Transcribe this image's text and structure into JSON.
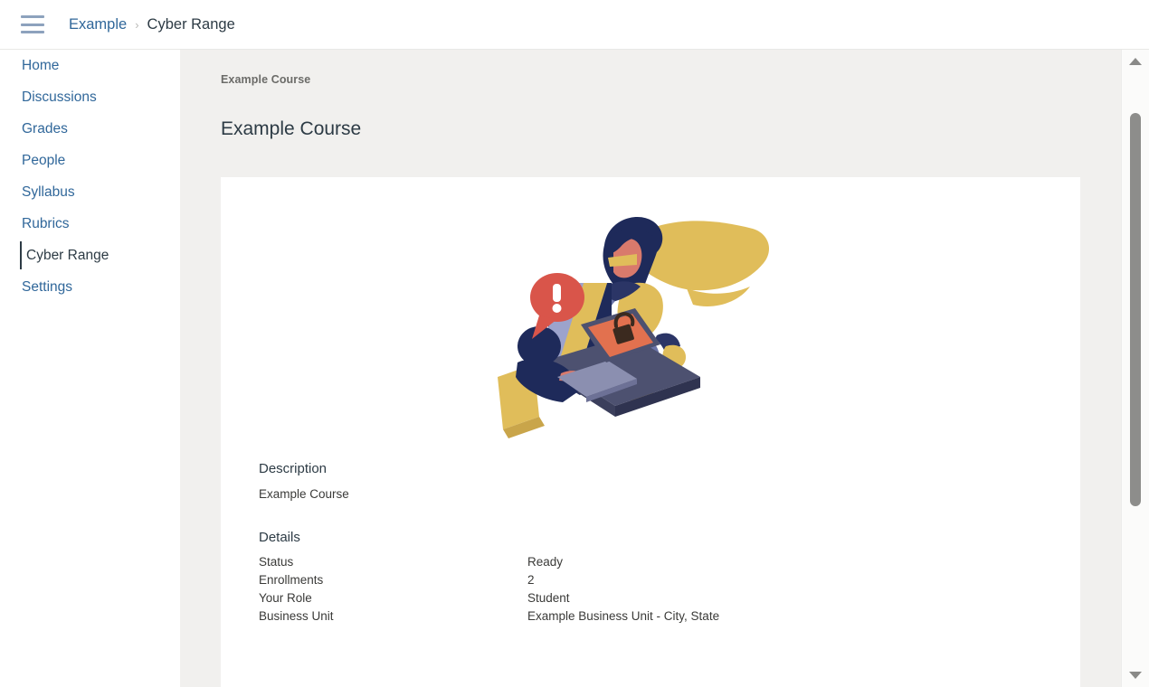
{
  "header": {
    "menu_icon": "hamburger-menu-icon",
    "breadcrumb": {
      "root_label": "Example",
      "separator": "›",
      "current_label": "Cyber Range"
    }
  },
  "sidebar": {
    "items": [
      {
        "label": "Home",
        "active": false
      },
      {
        "label": "Discussions",
        "active": false
      },
      {
        "label": "Grades",
        "active": false
      },
      {
        "label": "People",
        "active": false
      },
      {
        "label": "Syllabus",
        "active": false
      },
      {
        "label": "Rubrics",
        "active": false
      },
      {
        "label": "Cyber Range",
        "active": true
      },
      {
        "label": "Settings",
        "active": false
      }
    ]
  },
  "main": {
    "sub_breadcrumb": "Example Course",
    "page_title": "Example Course",
    "illustration": {
      "name": "cyber-security-hero-illustration",
      "alert_glyph": "!",
      "colors": {
        "gold": "#e0bd5a",
        "navy": "#1e2a5a",
        "periwinkle": "#6b74a8",
        "light_periwinkle": "#9ca3cc",
        "slate": "#4d5170",
        "dark_slate": "#3b3f5c",
        "coral": "#d9554a",
        "salmon": "#d97a6c",
        "orange": "#e2714f"
      }
    },
    "description": {
      "heading": "Description",
      "body": "Example Course"
    },
    "details": {
      "heading": "Details",
      "rows": [
        {
          "label": "Status",
          "value": "Ready"
        },
        {
          "label": "Enrollments",
          "value": "2"
        },
        {
          "label": "Your Role",
          "value": "Student"
        },
        {
          "label": "Business Unit",
          "value": "Example Business Unit - City, State"
        }
      ]
    }
  },
  "scrollbar": {
    "up_icon": "scroll-up-arrow-icon",
    "down_icon": "scroll-down-arrow-icon"
  }
}
